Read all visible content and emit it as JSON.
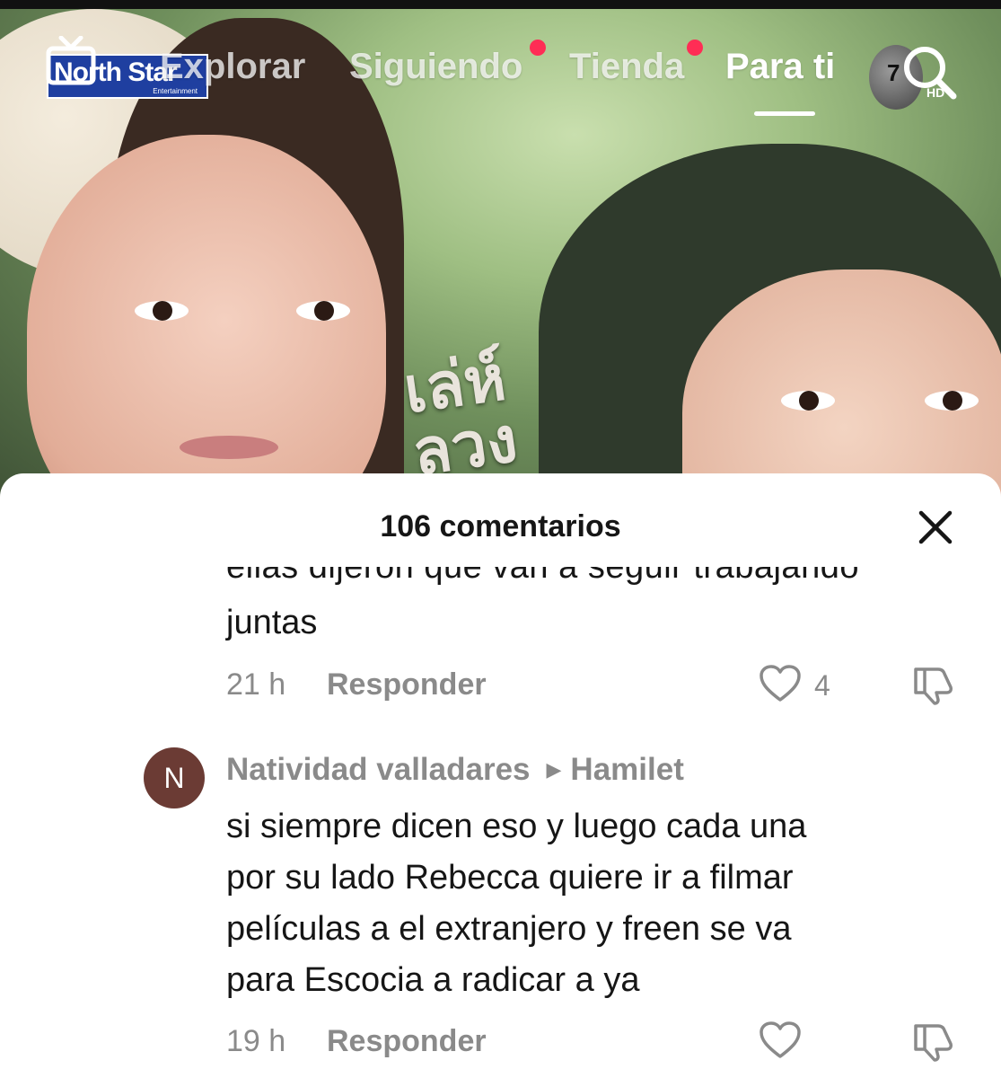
{
  "video": {
    "logo": {
      "brand": "North Star",
      "sub": "Entertainment",
      "live_icon": "live-tv-icon"
    },
    "title_art": "เล่ห์ลวง",
    "creator_badge": "7",
    "creator_badge_sub": "HD"
  },
  "nav": {
    "tabs": [
      {
        "label": "Explorar",
        "dot": false
      },
      {
        "label": "Siguiendo",
        "dot": true
      },
      {
        "label": "Tienda",
        "dot": true
      },
      {
        "label": "Para ti",
        "dot": false,
        "active": true
      }
    ],
    "search_icon": "search-icon",
    "dot_color": "#ff2d55"
  },
  "comments_panel": {
    "title": "106 comentarios",
    "close_icon": "close-icon",
    "comments": [
      {
        "cut_text": "ellas dijeron que van a seguir trabajando",
        "text": "juntas",
        "time": "21 h",
        "reply": "Responder",
        "likes": "4"
      },
      {
        "avatar_letter": "N",
        "author": "Natividad valladares",
        "reply_to": "Hamilet",
        "text_lines": [
          "si siempre dicen eso y luego cada una",
          "por su lado Rebecca quiere ir a filmar",
          "películas a el extranjero y freen se va",
          "para Escocia a radicar a ya"
        ],
        "time": "19 h",
        "reply": "Responder"
      }
    ]
  }
}
